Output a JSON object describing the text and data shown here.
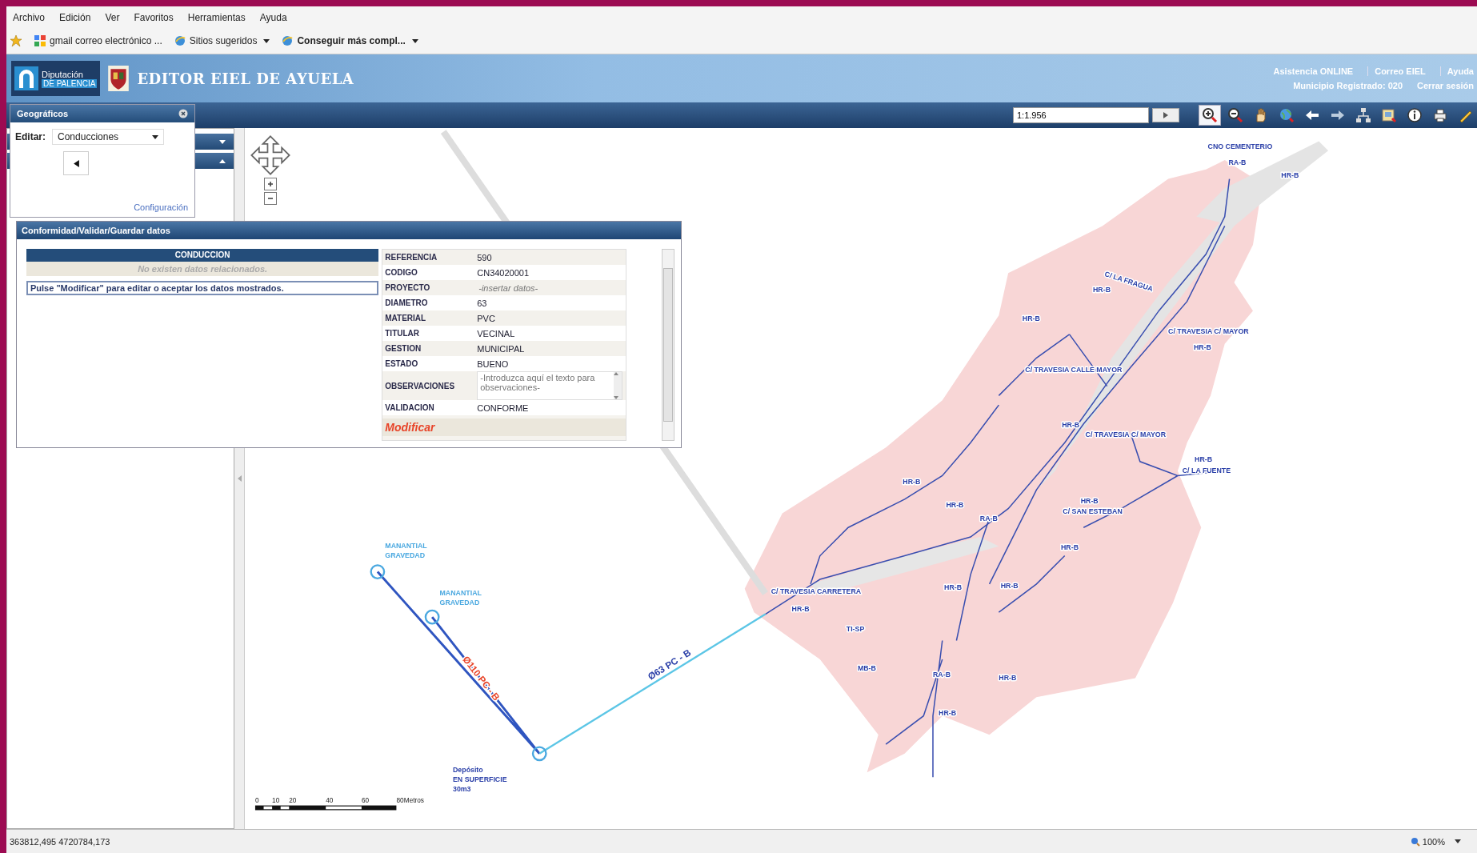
{
  "menu_bar": [
    "Archivo",
    "Edición",
    "Ver",
    "Favoritos",
    "Herramientas",
    "Ayuda"
  ],
  "favorites_bar": [
    {
      "kind": "site",
      "label": "gmail correo electrónico ..."
    },
    {
      "kind": "dropdown",
      "label": "Sitios sugeridos"
    },
    {
      "kind": "dropdown-bold",
      "label": "Conseguir más compl..."
    }
  ],
  "header": {
    "logo_lines": [
      "Diputación",
      "DE PALENCIA"
    ],
    "title": "EDITOR EIEL DE AYUELA",
    "links": [
      "Asistencia ONLINE",
      "Correo EIEL",
      "Ayuda"
    ],
    "municipality": "Municipio Registrado: 020",
    "logout": "Cerrar sesión"
  },
  "toolbar": {
    "scale": "1:1.956",
    "tools": [
      {
        "kind": "zoom-in",
        "selected": true
      },
      {
        "kind": "zoom-out",
        "selected": false
      },
      {
        "kind": "pan",
        "selected": false
      },
      {
        "kind": "globe",
        "selected": false
      },
      {
        "kind": "back",
        "selected": false
      },
      {
        "kind": "forward",
        "selected": false
      },
      {
        "kind": "network",
        "selected": false
      },
      {
        "kind": "layers",
        "selected": false
      },
      {
        "kind": "info",
        "selected": false
      },
      {
        "kind": "print",
        "selected": false
      },
      {
        "kind": "measure",
        "selected": false
      }
    ]
  },
  "layers_panel": {
    "title": "Geográficos",
    "edit_label": "Editar:",
    "edit_value": "Conducciones",
    "config_link": "Configuración"
  },
  "dialog": {
    "title": "Conformidad/Validar/Guardar datos",
    "entity": "CONDUCCION",
    "empty_message": "No existen datos relacionados.",
    "hint": "Pulse \"Modificar\" para editar o aceptar los datos mostrados.",
    "attributes": [
      {
        "name": "REFERENCIA",
        "kind": "text",
        "value": "590"
      },
      {
        "name": "CODIGO",
        "kind": "text",
        "value": "CN34020001"
      },
      {
        "name": "PROYECTO",
        "kind": "input",
        "placeholder": "-insertar datos-"
      },
      {
        "name": "DIAMETRO",
        "kind": "text",
        "value": "63"
      },
      {
        "name": "MATERIAL",
        "kind": "text",
        "value": "PVC"
      },
      {
        "name": "TITULAR",
        "kind": "text",
        "value": "VECINAL"
      },
      {
        "name": "GESTION",
        "kind": "text",
        "value": "MUNICIPAL"
      },
      {
        "name": "ESTADO",
        "kind": "text",
        "value": "BUENO"
      },
      {
        "name": "OBSERVACIONES",
        "kind": "textarea",
        "placeholder": "-Introduzca aquí el texto para observaciones-"
      },
      {
        "name": "VALIDACION",
        "kind": "text",
        "value": "CONFORME"
      }
    ],
    "action": "Modificar"
  },
  "map": {
    "labels": [
      {
        "kind": "spring",
        "lines": [
          "MANANTIAL",
          "GRAVEDAD"
        ]
      },
      {
        "kind": "spring",
        "lines": [
          "MANANTIAL",
          "GRAVEDAD"
        ]
      },
      {
        "kind": "tank",
        "lines": [
          "Depósito",
          "EN SUPERFICIE",
          "30m3"
        ]
      },
      {
        "kind": "pipe",
        "lines": [
          "Ø63 PC - B"
        ]
      },
      {
        "kind": "pipe-selected",
        "lines": [
          "Ø110 PC - B"
        ]
      },
      {
        "kind": "street",
        "lines": [
          "CNO CEMENTERIO"
        ]
      },
      {
        "kind": "node",
        "lines": [
          "RA-B"
        ]
      },
      {
        "kind": "node",
        "lines": [
          "HR-B"
        ]
      },
      {
        "kind": "street",
        "lines": [
          "C/ LA FRAGUA"
        ]
      },
      {
        "kind": "node",
        "lines": [
          "HR-B"
        ]
      },
      {
        "kind": "node",
        "lines": [
          "HR-B"
        ]
      },
      {
        "kind": "street",
        "lines": [
          "C/ TRAVESIA C/ MAYOR"
        ]
      },
      {
        "kind": "node",
        "lines": [
          "HR-B"
        ]
      },
      {
        "kind": "street",
        "lines": [
          "C/ TRAVESIA CALLE MAYOR"
        ]
      },
      {
        "kind": "node",
        "lines": [
          "HR-B"
        ]
      },
      {
        "kind": "street",
        "lines": [
          "C/ TRAVESIA C/ MAYOR"
        ]
      },
      {
        "kind": "node",
        "lines": [
          "HR-B"
        ]
      },
      {
        "kind": "street",
        "lines": [
          "C/ LA FUENTE"
        ]
      },
      {
        "kind": "node",
        "lines": [
          "HR-B"
        ]
      },
      {
        "kind": "street",
        "lines": [
          "C/ SAN ESTEBAN"
        ]
      },
      {
        "kind": "node",
        "lines": [
          "RA-B"
        ]
      },
      {
        "kind": "node",
        "lines": [
          "HR-B"
        ]
      },
      {
        "kind": "node",
        "lines": [
          "HR-B"
        ]
      },
      {
        "kind": "node",
        "lines": [
          "HR-B"
        ]
      },
      {
        "kind": "node",
        "lines": [
          "HR-B"
        ]
      },
      {
        "kind": "node",
        "lines": [
          "HR-B"
        ]
      },
      {
        "kind": "node",
        "lines": [
          "TI-SP"
        ]
      },
      {
        "kind": "node",
        "lines": [
          "MB-B"
        ]
      },
      {
        "kind": "node",
        "lines": [
          "RA-B"
        ]
      },
      {
        "kind": "node",
        "lines": [
          "HR-B"
        ]
      },
      {
        "kind": "node",
        "lines": [
          "HR-B"
        ]
      },
      {
        "kind": "street",
        "lines": [
          "C/ TRAVESIA CARRETERA"
        ]
      },
      {
        "kind": "node",
        "lines": [
          "HR-B"
        ]
      }
    ]
  },
  "scale_bar": {
    "ticks": [
      "0",
      "10",
      "20",
      "40",
      "60",
      "80"
    ],
    "unit": "Metros"
  },
  "status_bar": {
    "coordinates": "363812,495 4720784,173",
    "zoom": "100%"
  }
}
